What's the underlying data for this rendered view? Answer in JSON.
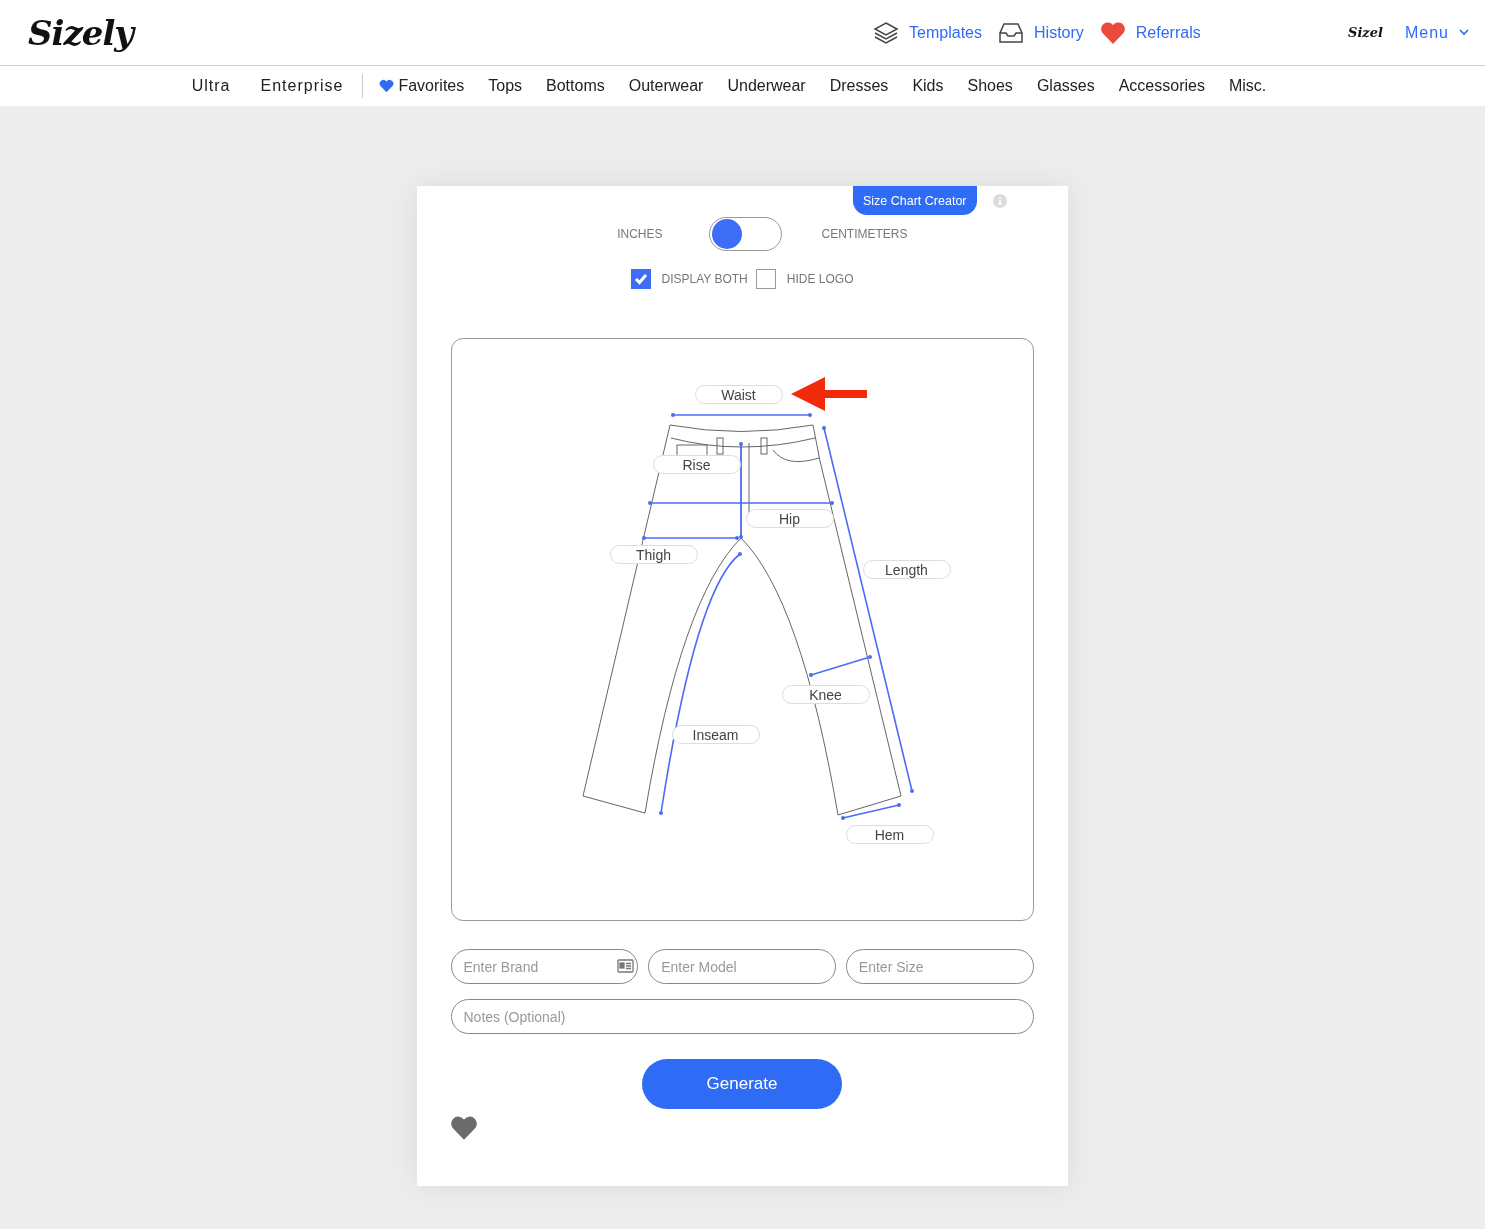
{
  "header": {
    "logo": "Sizely",
    "links": [
      {
        "label": "Templates",
        "kind": "layers"
      },
      {
        "label": "History",
        "kind": "inbox"
      },
      {
        "label": "Referrals",
        "kind": "heart"
      }
    ],
    "small_logo": "Sizel",
    "menu": "Menu"
  },
  "categories": [
    {
      "label": "Ultra",
      "kind": "plain"
    },
    {
      "label": "Enterprise",
      "kind": "plain"
    },
    {
      "label": "Favorites",
      "kind": "favorite"
    },
    {
      "label": "Tops",
      "kind": "item"
    },
    {
      "label": "Bottoms",
      "kind": "item"
    },
    {
      "label": "Outerwear",
      "kind": "item"
    },
    {
      "label": "Underwear",
      "kind": "item"
    },
    {
      "label": "Dresses",
      "kind": "item"
    },
    {
      "label": "Kids",
      "kind": "item"
    },
    {
      "label": "Shoes",
      "kind": "item"
    },
    {
      "label": "Glasses",
      "kind": "item"
    },
    {
      "label": "Accessories",
      "kind": "item"
    },
    {
      "label": "Misc.",
      "kind": "item"
    }
  ],
  "card": {
    "badge": "Size Chart Creator",
    "units": {
      "left": "INCHES",
      "right": "CENTIMETERS",
      "on": false
    },
    "options": [
      {
        "label": "DISPLAY BOTH",
        "checked": true
      },
      {
        "label": "HIDE LOGO",
        "checked": false
      }
    ],
    "measurements": [
      "Waist",
      "Rise",
      "Hip",
      "Thigh",
      "Length",
      "Knee",
      "Inseam",
      "Hem"
    ],
    "fields": [
      {
        "placeholder": "Enter Brand",
        "kind": "brand"
      },
      {
        "placeholder": "Enter Model",
        "kind": "plain"
      },
      {
        "placeholder": "Enter Size",
        "kind": "plain"
      }
    ],
    "notes": {
      "placeholder": "Notes (Optional)"
    },
    "button": "Generate"
  }
}
